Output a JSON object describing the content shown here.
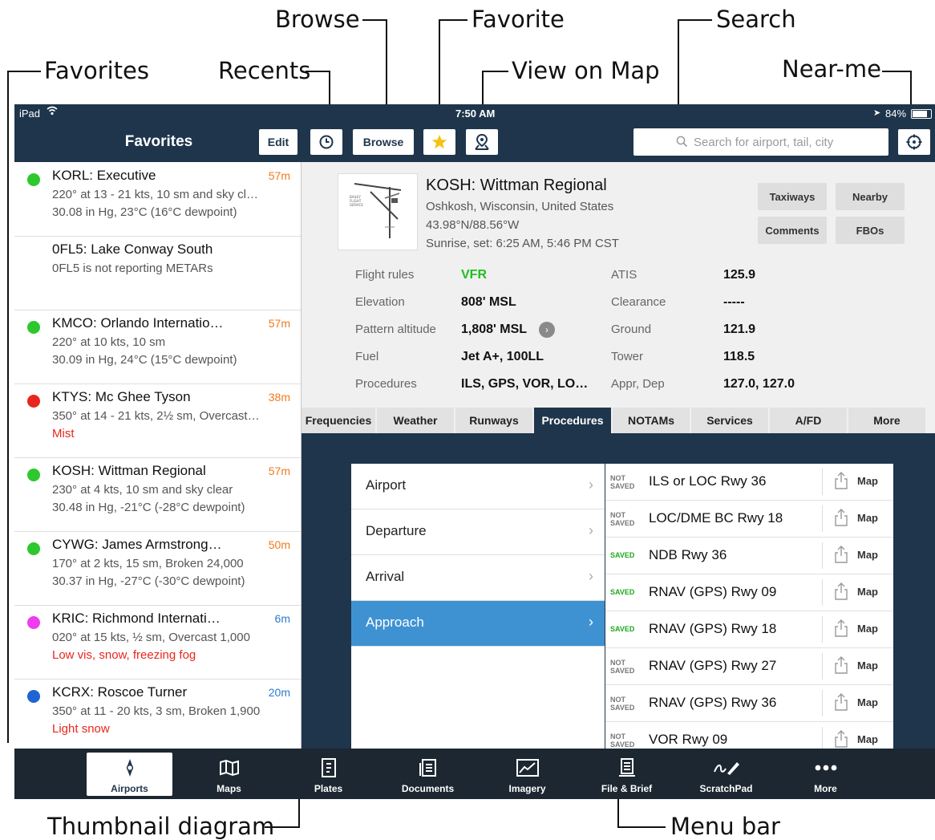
{
  "callouts": {
    "browse": "Browse",
    "favorite": "Favorite",
    "search": "Search",
    "favorites": "Favorites",
    "recents": "Recents",
    "view_on_map": "View on Map",
    "near_me": "Near-me",
    "thumbnail": "Thumbnail diagram",
    "menu_bar": "Menu bar"
  },
  "status": {
    "device": "iPad",
    "time": "7:50 AM",
    "battery": "84%"
  },
  "nav": {
    "title": "Favorites",
    "edit": "Edit",
    "browse": "Browse",
    "search_placeholder": "Search for airport, tail, city",
    "icons": {
      "recents": "clock-icon",
      "favorite": "star-icon",
      "map": "map-pin-icon",
      "near_me": "crosshair-icon"
    }
  },
  "favorites": [
    {
      "title": "KORL: Executive",
      "line1": "220° at 13 - 21 kts, 10 sm and sky cl…",
      "line2": "30.08 in Hg, 23°C (16°C dewpoint)",
      "age": "57m",
      "color": "#2ec82e",
      "age_color": "#f07a1e",
      "line2_color": "#555555"
    },
    {
      "title": "0FL5: Lake Conway South",
      "line1": "0FL5 is not reporting METARs",
      "line2": "",
      "age": "",
      "color": "",
      "age_color": "#f07a1e",
      "line2_color": "#555555"
    },
    {
      "title": "KMCO: Orlando Internatio…",
      "line1": "220° at 10 kts, 10 sm",
      "line2": "30.09 in Hg, 24°C (15°C dewpoint)",
      "age": "57m",
      "color": "#2ec82e",
      "age_color": "#f07a1e",
      "line2_color": "#555555"
    },
    {
      "title": "KTYS: Mc Ghee Tyson",
      "line1": "350° at 14 - 21 kts, 2½ sm, Overcast…",
      "line2": "Mist",
      "age": "38m",
      "color": "#e8261e",
      "age_color": "#f07a1e",
      "line2_color": "#e8261e"
    },
    {
      "title": "KOSH: Wittman Regional",
      "line1": "230° at 4 kts, 10 sm and sky clear",
      "line2": "30.48 in Hg, -21°C (-28°C dewpoint)",
      "age": "57m",
      "color": "#2ec82e",
      "age_color": "#f07a1e",
      "line2_color": "#555555"
    },
    {
      "title": "CYWG: James Armstrong…",
      "line1": "170° at 2 kts, 15 sm, Broken 24,000",
      "line2": "30.37 in Hg, -27°C (-30°C dewpoint)",
      "age": "50m",
      "color": "#2ec82e",
      "age_color": "#f07a1e",
      "line2_color": "#555555"
    },
    {
      "title": "KRIC: Richmond Internati…",
      "line1": "020° at 15 kts, ½ sm, Overcast 1,000",
      "line2": "Low vis, snow, freezing fog",
      "age": "6m",
      "color": "#ee3cee",
      "age_color": "#2a7bd0",
      "line2_color": "#e8261e"
    },
    {
      "title": "KCRX: Roscoe Turner",
      "line1": "350° at 11 - 20 kts, 3 sm, Broken 1,900",
      "line2": "Light snow",
      "age": "20m",
      "color": "#1e64d2",
      "age_color": "#2a7bd0",
      "line2_color": "#e8261e"
    }
  ],
  "airport": {
    "title": "KOSH: Wittman Regional",
    "location": "Oshkosh, Wisconsin, United States",
    "coords": "43.98°N/88.56°W",
    "sun": "Sunrise, set: 6:25 AM, 5:46 PM CST",
    "buttons": [
      "Taxiways",
      "Nearby",
      "Comments",
      "FBOs"
    ],
    "info_left": [
      {
        "label": "Flight rules",
        "value": "VFR",
        "color": "#1fbf1f"
      },
      {
        "label": "Elevation",
        "value": "808' MSL",
        "color": "#111111"
      },
      {
        "label": "Pattern altitude",
        "value": "1,808' MSL",
        "color": "#111111"
      },
      {
        "label": "Fuel",
        "value": "Jet A+, 100LL",
        "color": "#111111"
      },
      {
        "label": "Procedures",
        "value": "ILS, GPS, VOR, LO…",
        "color": "#111111"
      }
    ],
    "info_right": [
      {
        "label": "ATIS",
        "value": "125.9"
      },
      {
        "label": "Clearance",
        "value": "-----"
      },
      {
        "label": "Ground",
        "value": "121.9"
      },
      {
        "label": "Tower",
        "value": "118.5"
      },
      {
        "label": "Appr, Dep",
        "value": "127.0, 127.0"
      }
    ]
  },
  "tabs": [
    "Frequencies",
    "Weather",
    "Runways",
    "Procedures",
    "NOTAMs",
    "Services",
    "A/FD",
    "More"
  ],
  "active_tab": "Procedures",
  "categories": [
    "Airport",
    "Departure",
    "Arrival",
    "Approach"
  ],
  "active_category": "Approach",
  "procedures": [
    {
      "status": "NOT SAVED",
      "name": "ILS or LOC Rwy 36",
      "map": "Map"
    },
    {
      "status": "NOT SAVED",
      "name": "LOC/DME BC Rwy 18",
      "map": "Map"
    },
    {
      "status": "SAVED",
      "name": "NDB Rwy 36",
      "map": "Map"
    },
    {
      "status": "SAVED",
      "name": "RNAV (GPS) Rwy 09",
      "map": "Map"
    },
    {
      "status": "SAVED",
      "name": "RNAV (GPS) Rwy 18",
      "map": "Map"
    },
    {
      "status": "NOT SAVED",
      "name": "RNAV (GPS) Rwy 27",
      "map": "Map"
    },
    {
      "status": "NOT SAVED",
      "name": "RNAV (GPS) Rwy 36",
      "map": "Map"
    },
    {
      "status": "NOT SAVED",
      "name": "VOR Rwy 09",
      "map": "Map"
    }
  ],
  "tabbar": [
    {
      "label": "Airports",
      "icon": "compass-icon"
    },
    {
      "label": "Maps",
      "icon": "map-icon"
    },
    {
      "label": "Plates",
      "icon": "plates-icon"
    },
    {
      "label": "Documents",
      "icon": "documents-icon"
    },
    {
      "label": "Imagery",
      "icon": "imagery-icon"
    },
    {
      "label": "File & Brief",
      "icon": "file-brief-icon"
    },
    {
      "label": "ScratchPad",
      "icon": "scratchpad-icon"
    },
    {
      "label": "More",
      "icon": "more-icon"
    }
  ],
  "active_tabbar": "Airports",
  "colors": {
    "navy": "#1e354c",
    "accent_blue": "#3f92d2",
    "saved_green": "#1fa81f",
    "tabbar": "#1c2731"
  }
}
